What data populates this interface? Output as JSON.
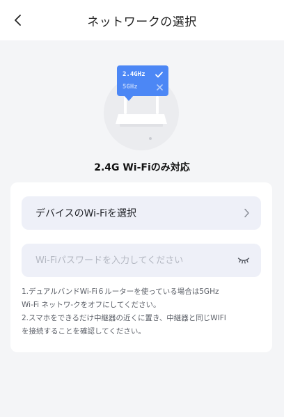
{
  "header": {
    "back_icon": "chevron-left-icon",
    "title": "ネットワークの選択"
  },
  "illustration": {
    "band_24": "2.4GHz",
    "band_5": "5GHz",
    "band_24_status_icon": "check-icon",
    "band_5_status_icon": "close-icon",
    "accent_color": "#4c87f5"
  },
  "caption": "2.4G Wi-Fiのみ対応",
  "form": {
    "select_wifi_label": "デバイスのWi-Fiを選択",
    "select_wifi_icon": "chevron-right-icon",
    "password_placeholder": "Wi-Fiパスワードを入力してください",
    "password_value": "",
    "password_toggle_icon": "eye-closed-icon"
  },
  "notes": [
    "1.デュアルバンドWi-Fi６ルーターを使っている場合は5GHz",
    "Wi-Fi ネットワ-クをオフにしてください。",
    "2.スマホをできるだけ中継器の近くに置き、中継器と同じWIFI",
    "を接続することを確認してください。"
  ]
}
